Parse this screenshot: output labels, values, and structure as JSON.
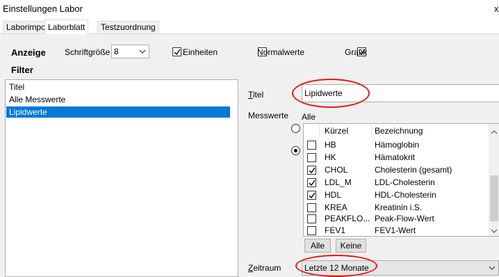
{
  "window": {
    "title": "Einstellungen Labor",
    "close": "x"
  },
  "tabs": [
    {
      "label": "Laborimport",
      "active": false
    },
    {
      "label": "Laborblatt",
      "active": true
    },
    {
      "label": "Testzuordnung",
      "active": false
    }
  ],
  "anzeige": {
    "heading": "Anzeige",
    "font_size_label": "Schriftgröße",
    "font_size_value": "8",
    "einheiten_label": "Einheiten",
    "einheiten_checked": true,
    "normalwerte_label": "Normalwerte",
    "normalwerte_checked": false,
    "grafik_label": "Grafik",
    "grafik_checked": true
  },
  "filter": {
    "heading": "Filter",
    "items": [
      {
        "label": "Titel",
        "selected": false
      },
      {
        "label": "Alle Messwerte",
        "selected": false
      },
      {
        "label": "Lipidwerte",
        "selected": true
      }
    ]
  },
  "detail": {
    "title_label_u": "T",
    "title_label_rest": "itel",
    "title_value": "Lipidwerte",
    "messwerte_label": "Messwerte",
    "alle_radio_label": "Alle",
    "grid_headers": {
      "kuerzel": "Kürzel",
      "bezeichnung": "Bezeichnung"
    },
    "grid_rows": [
      {
        "code": "HB",
        "name": "Hämoglobin",
        "checked": false
      },
      {
        "code": "HK",
        "name": "Hämatokrit",
        "checked": false
      },
      {
        "code": "CHOL",
        "name": "Cholesterin (gesamt)",
        "checked": true
      },
      {
        "code": "LDL_M",
        "name": "LDL-Cholesterin",
        "checked": true
      },
      {
        "code": "HDL",
        "name": "HDL-Cholesterin",
        "checked": true
      },
      {
        "code": "KREA",
        "name": "Kreatinin i.S.",
        "checked": false
      },
      {
        "code": "PEAKFLO...",
        "name": "Peak-Flow-Wert",
        "checked": false
      },
      {
        "code": "FEV1",
        "name": "FEV1-Wert",
        "checked": false
      }
    ],
    "btn_alle": "Alle",
    "btn_keine": "Keine",
    "zeitraum_label_u": "Z",
    "zeitraum_label_rest": "eitraum",
    "zeitraum_value": "Letzte 12 Monate"
  },
  "colors": {
    "selection": "#0078d7",
    "annotation": "#e01b1b",
    "panel": "#f0f0f0"
  },
  "icons": [
    "chevron-down-icon",
    "chevron-up-icon",
    "check-icon",
    "radio-dot-icon"
  ]
}
